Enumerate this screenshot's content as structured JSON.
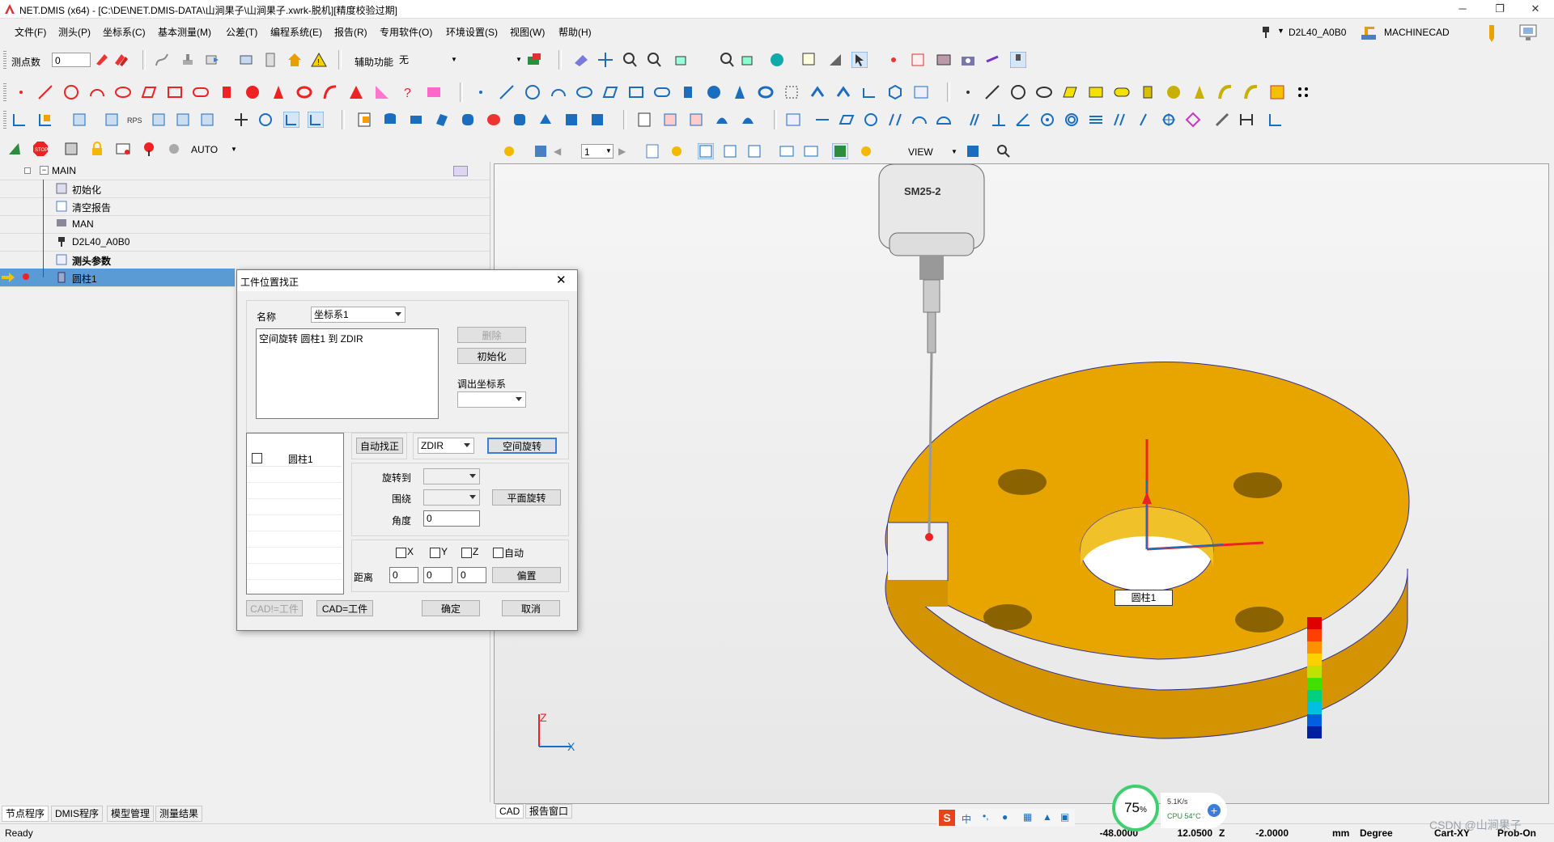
{
  "window": {
    "title": "NET.DMIS (x64) - [C:\\DE\\NET.DMIS-DATA\\山涧果子\\山涧果子.xwrk-脱机][精度校验过期]",
    "minimize": "─",
    "restore": "❐",
    "close": "✕"
  },
  "menu": [
    "文件(F)",
    "测头(P)",
    "坐标系(C)",
    "基本测量(M)",
    "公差(T)",
    "编程系统(E)",
    "报告(R)",
    "专用软件(O)",
    "环境设置(S)",
    "视图(W)",
    "帮助(H)"
  ],
  "user": {
    "probe": "D2L40_A0B0",
    "machine": "MACHINECAD"
  },
  "toolbar1": {
    "points_label": "测点数",
    "points_value": "0",
    "aux_label": "辅助功能",
    "aux_value": "无",
    "aux2_value": ""
  },
  "toolbar4": {
    "auto_label": "AUTO"
  },
  "tree": {
    "root": "MAIN",
    "items": [
      {
        "label": "初始化"
      },
      {
        "label": "清空报告"
      },
      {
        "label": "MAN"
      },
      {
        "label": "D2L40_A0B0"
      },
      {
        "label": "测头参数"
      },
      {
        "label": "圆柱1"
      }
    ]
  },
  "bottom_tabs": [
    "节点程序",
    "DMIS程序",
    "模型管理",
    "测量结果"
  ],
  "status": {
    "ready": "Ready",
    "x": "-48.0000",
    "y": "12.0500",
    "z_label": "Z",
    "z": "-2.0000",
    "unit": "mm",
    "angle": "Degree",
    "cs": "Cart-XY",
    "probe": "Prob-On"
  },
  "view_toolbar": {
    "page_value": "1",
    "view_label": "VIEW"
  },
  "viewport": {
    "probe_label": "SM25-2",
    "feature_label": "圆柱1",
    "axis_x": "X",
    "axis_z": "Z",
    "tabs": [
      "CAD",
      "报告窗口"
    ]
  },
  "dialog": {
    "title": "工件位置找正",
    "close": "✕",
    "name_label": "名称",
    "name_value": "坐标系1",
    "list_text": "空间旋转 圆柱1 到 ZDIR",
    "delete": "删除",
    "init": "初始化",
    "recall_label": "调出坐标系",
    "recall_value": "",
    "feature_item": "圆柱1",
    "auto_align": "自动找正",
    "dir_value": "ZDIR",
    "space_rotate": "空间旋转",
    "rotate_to_label": "旋转到",
    "around_label": "围绕",
    "angle_label": "角度",
    "angle_value": "0",
    "plane_rotate": "平面旋转",
    "chk_x": "X",
    "chk_y": "Y",
    "chk_z": "Z",
    "chk_auto": "自动",
    "dist_label": "距离",
    "dist_x": "0",
    "dist_y": "0",
    "dist_z": "0",
    "offset": "偏置",
    "cad_ne_part": "CAD!=工件",
    "cad_eq_part": "CAD=工件",
    "ok": "确定",
    "cancel": "取消"
  },
  "tray": {
    "percent": "75",
    "percent_sign": "%",
    "net": "5.1K/s",
    "cpu": "CPU 54°C",
    "ime": "中",
    "watermark": "CSDN @山涧果子"
  },
  "colors": {
    "part": "#e8a500",
    "part_side": "#d49300",
    "select": "#5b9bd5",
    "accent": "#3b7dd8"
  }
}
